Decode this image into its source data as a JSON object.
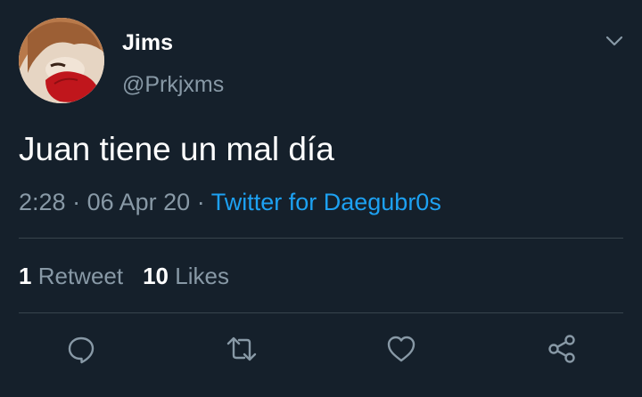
{
  "user": {
    "display_name": "Jims",
    "handle": "@Prkjxms"
  },
  "tweet": {
    "text": "Juan tiene un mal día",
    "time": "2:28",
    "date": "06 Apr 20",
    "separator": "·",
    "source": "Twitter for Daegubr0s"
  },
  "stats": {
    "retweets_count": "1",
    "retweets_label": "Retweet",
    "likes_count": "10",
    "likes_label": "Likes"
  },
  "icons": {
    "menu": "chevron-down-icon",
    "reply": "reply-icon",
    "retweet": "retweet-icon",
    "like": "heart-icon",
    "share": "share-icon"
  },
  "colors": {
    "background": "#15202b",
    "text_primary": "#ffffff",
    "text_secondary": "#8899a6",
    "link": "#1da1f2",
    "divider": "#38444d"
  }
}
